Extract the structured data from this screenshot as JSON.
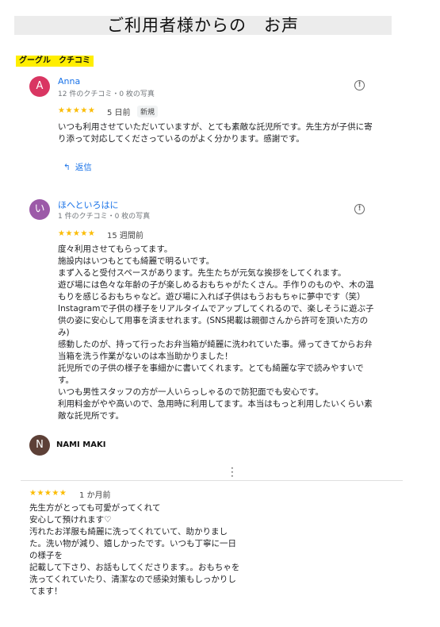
{
  "page_title": "ご利用者様からの　お声",
  "section_label": "グーグル　クチコミ",
  "reviews": [
    {
      "avatar_letter": "A",
      "avatar_color": "#d93662",
      "name": "Anna",
      "meta": "12 件のクチコミ・0 枚の写真",
      "stars": "★★★★★",
      "date": "5 日前",
      "badge": "新規",
      "text": "いつも利用させていただいていますが、とても素敵な託児所です。先生方が子供に寄\nり添って対応してくださっているのがよく分かります。感謝です。",
      "reply_label": "返信"
    },
    {
      "avatar_letter": "い",
      "avatar_color": "#9c5aa8",
      "name": "ほへといろはに",
      "meta": "1 件のクチコミ・0 枚の写真",
      "stars": "★★★★★",
      "date": "15 週間前",
      "text": "度々利用させてもらってます。\n施設内はいつもとても綺麗で明るいです。\nまず入ると受付スペースがあります。先生たちが元気な挨拶をしてくれます。\n遊び場には色々な年齢の子が楽しめるおもちゃがたくさん。手作りのものや、木の温\nもりを感じるおもちゃなど。遊び場に入れば子供はもうおもちゃに夢中です（笑）\nInstagramで子供の様子をリアルタイムでアップしてくれるので、楽しそうに遊ぶ子\n供の姿に安心して用事を済ませれます。(SNS掲載は親御さんから許可を頂いた方の\nみ)\n感動したのが、持って行ったお弁当箱が綺麗に洗われていた事。帰ってきてからお弁\n当箱を洗う作業がないのは本当助かりました！\n託児所での子供の様子を事細かに書いてくれます。とても綺麗な字で読みやすいで\nす。\nいつも男性スタッフの方が一人いらっしゃるので防犯面でも安心です。\n利用料金がやや高いので、急用時に利用してます。本当はもっと利用したいくらい素\n敵な託児所です。"
    },
    {
      "avatar_letter": "N",
      "avatar_color": "#5d4037",
      "name": "NAMI MAKI",
      "stars": "★★★★★",
      "date": "1 か月前",
      "text": "先生方がとっても可愛がってくれて\n安心して預けれます♡\n汚れたお洋服も綺麗に洗ってくれていて、助かりまし\nた。洗い物が減り、嬉しかったです。いつも丁寧に一日\nの様子を\n記載して下さり、お話もしてくださります。。おもちゃを\n洗ってくれていたり、清潔なので感染対策もしっかりし\nてます！"
    }
  ]
}
